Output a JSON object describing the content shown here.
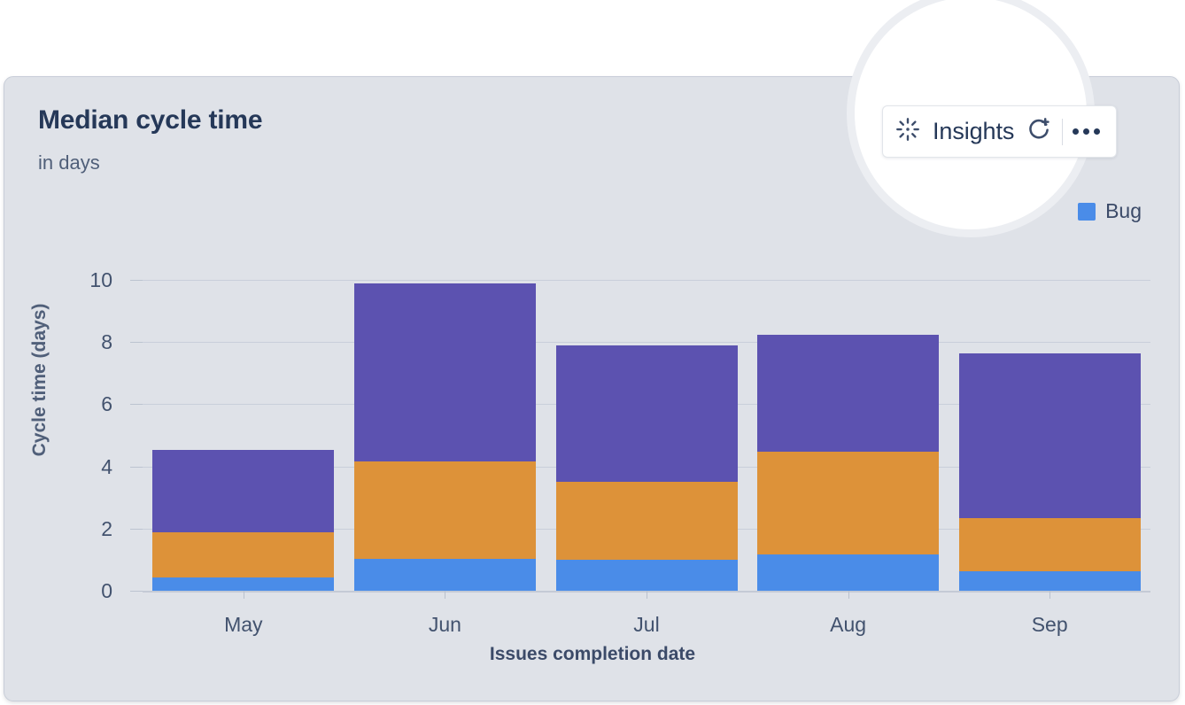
{
  "card": {
    "title": "Median cycle time",
    "subtitle": "in days"
  },
  "toolbar": {
    "insights_label": "Insights",
    "insights_icon": "sparkle-burst-icon",
    "refresh_icon": "refresh-add-icon",
    "more_icon": "more-options-icon"
  },
  "legend": {
    "items": [
      {
        "label": "",
        "color": "#5c52b0"
      },
      {
        "label": "Bug",
        "color": "#4a8ce8"
      }
    ]
  },
  "chart_data": {
    "type": "bar",
    "title": "Median cycle time",
    "subtitle": "in days",
    "xlabel": "Issues completion date",
    "ylabel": "Cycle time (days)",
    "ylim": [
      0,
      10.8
    ],
    "yticks": [
      0,
      2,
      4,
      6,
      8,
      10
    ],
    "ytick_labels": [
      "0",
      "2",
      "4",
      "6",
      "8",
      "10"
    ],
    "grid": true,
    "stacked": true,
    "legend_position": "top-right",
    "categories": [
      "May",
      "Jun",
      "Jul",
      "Aug",
      "Sep"
    ],
    "series": [
      {
        "name": "Bug",
        "color": "#4a8ce8",
        "values": [
          0.43,
          1.03,
          1.0,
          1.17,
          0.63
        ]
      },
      {
        "name": "",
        "color": "#dd9239",
        "values": [
          1.46,
          3.14,
          2.51,
          3.29,
          1.71
        ]
      },
      {
        "name": "",
        "color": "#5c52b0",
        "values": [
          2.63,
          5.71,
          4.37,
          3.77,
          5.31
        ]
      }
    ],
    "totals": [
      4.52,
      9.88,
      7.88,
      8.23,
      7.65
    ]
  },
  "colors": {
    "card_background": "#dfe2e8",
    "page_background": "#ffffff",
    "grid": "#c9cfda",
    "text_primary": "#253858",
    "text_secondary": "#505f79"
  }
}
